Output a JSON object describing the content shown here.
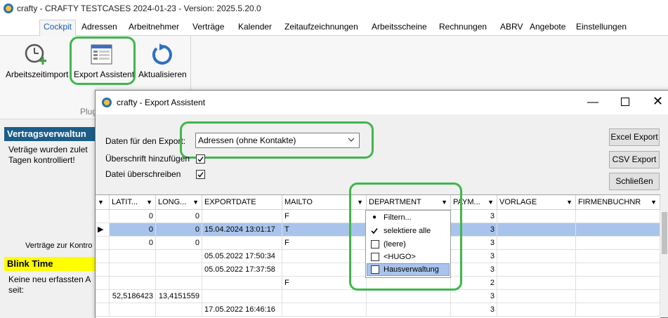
{
  "window": {
    "title": "crafty - CRAFTY TESTCASES 2024-01-23 - Version: 2025.5.20.0"
  },
  "tabs": [
    "Cockpit",
    "Adressen",
    "Arbeitnehmer",
    "Verträge",
    "Kalender",
    "Zeitaufzeichnungen",
    "Arbeitsscheine",
    "Rechnungen",
    "ABRV",
    "Angebote",
    "Einstellungen"
  ],
  "ribbon": {
    "buttons": [
      "Arbeitszeitimport",
      "Export Assistent",
      "Aktualisieren"
    ],
    "group_label": "Plug"
  },
  "panels": {
    "vertrag": {
      "title": "Vertragsverwaltun",
      "text1": "Veträge wurden zulet",
      "text2": "Tagen kontrolliert!",
      "footer": "Verträge zur Kontro"
    },
    "blink": {
      "title": "Blink Time",
      "text1": "Keine neu erfassten A",
      "text2": "seit:"
    }
  },
  "dialog": {
    "title": "crafty - Export Assistent",
    "export_label": "Daten für den Export:",
    "export_value": "Adressen (ohne Kontakte)",
    "overschrift_label": "Überschrift hinzufügen",
    "overschrift_checked": true,
    "datei_label": "Datei überschreiben",
    "datei_checked": true,
    "buttons": {
      "excel": "Excel Export",
      "csv": "CSV Export",
      "close": "Schließen"
    },
    "columns": [
      "LATIT...",
      "LONG...",
      "EXPORTDATE",
      "MAILTO",
      "DEPARTMENT",
      "PAYM...",
      "VORLAGE",
      "FIRMENBUCHNR"
    ],
    "rows": [
      [
        "0",
        "0",
        "",
        "F",
        "",
        "3",
        "",
        ""
      ],
      [
        "0",
        "0",
        "15.04.2024 13:01:17",
        "T",
        "",
        "3",
        "",
        ""
      ],
      [
        "0",
        "0",
        "",
        "F",
        "",
        "3",
        "",
        ""
      ],
      [
        "",
        "",
        "05.05.2022 17:50:34",
        "",
        "",
        "3",
        "",
        ""
      ],
      [
        "",
        "",
        "05.05.2022 17:37:58",
        "",
        "",
        "3",
        "",
        ""
      ],
      [
        "",
        "",
        "",
        "F",
        "",
        "2",
        "",
        ""
      ],
      [
        "52,5186423",
        "13,4151559",
        "",
        "",
        "",
        "3",
        "",
        ""
      ],
      [
        "",
        "",
        "17.05.2022 16:46:16",
        "",
        "",
        "3",
        "",
        ""
      ]
    ],
    "selected_row": 1,
    "dropdown": {
      "items": [
        "Filtern...",
        "selektiere alle",
        "(leere)",
        "<HUGO>",
        "Hausverwaltung"
      ]
    }
  }
}
